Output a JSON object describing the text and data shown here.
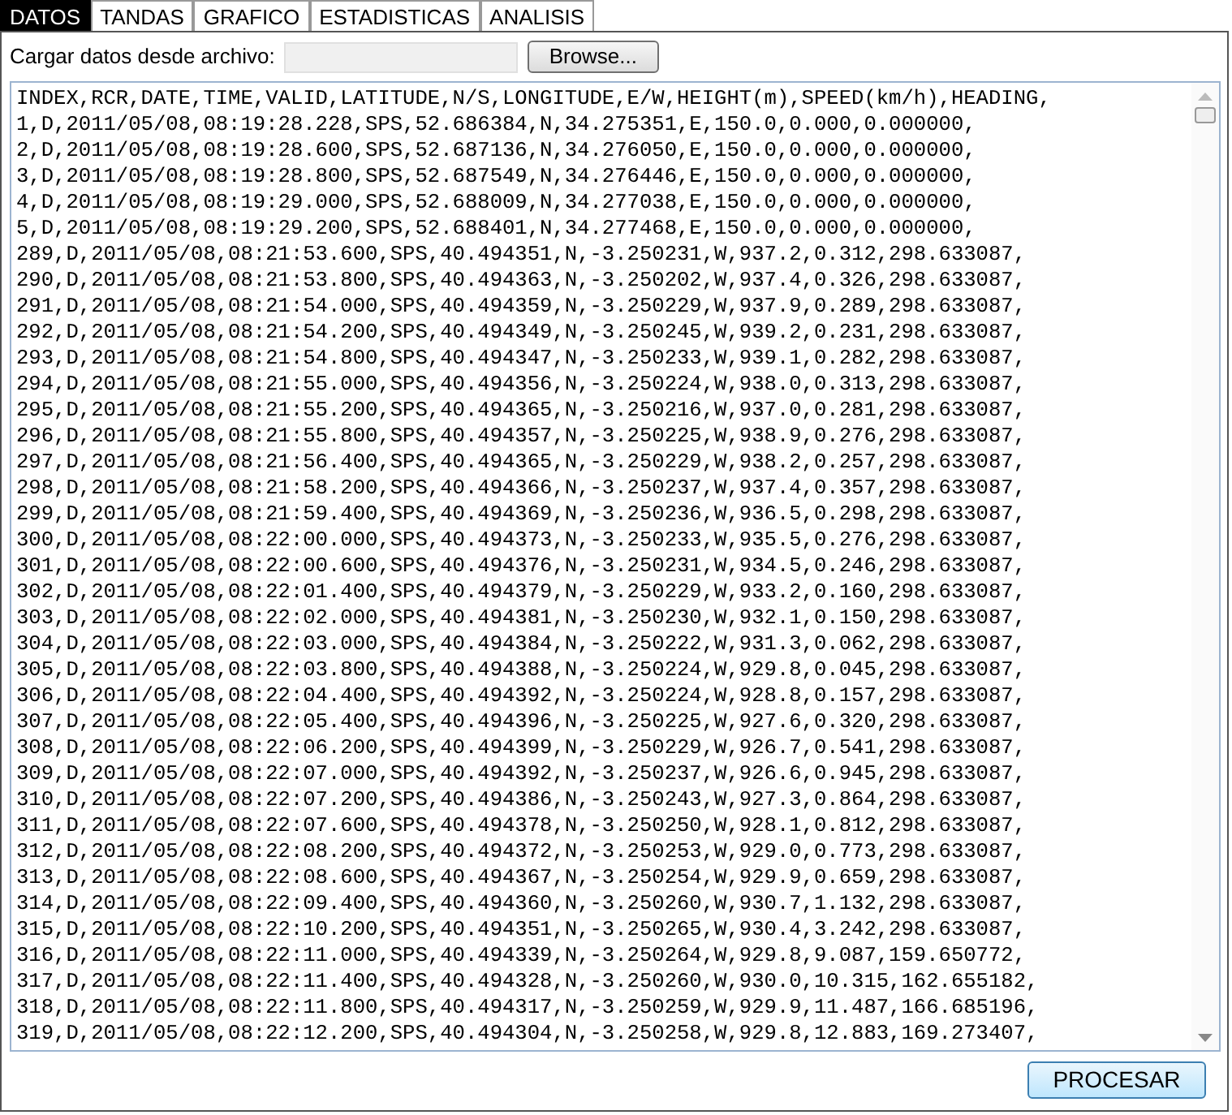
{
  "tabs": [
    {
      "label": "DATOS",
      "selected": true
    },
    {
      "label": "TANDAS",
      "selected": false
    },
    {
      "label": "GRAFICO",
      "selected": false
    },
    {
      "label": "ESTADISTICAS",
      "selected": false
    },
    {
      "label": "ANALISIS",
      "selected": false
    }
  ],
  "file_label": "Cargar datos desde archivo:",
  "browse_button": "Browse...",
  "lines": [
    "INDEX,RCR,DATE,TIME,VALID,LATITUDE,N/S,LONGITUDE,E/W,HEIGHT(m),SPEED(km/h),HEADING,",
    "1,D,2011/05/08,08:19:28.228,SPS,52.686384,N,34.275351,E,150.0,0.000,0.000000,",
    "2,D,2011/05/08,08:19:28.600,SPS,52.687136,N,34.276050,E,150.0,0.000,0.000000,",
    "3,D,2011/05/08,08:19:28.800,SPS,52.687549,N,34.276446,E,150.0,0.000,0.000000,",
    "4,D,2011/05/08,08:19:29.000,SPS,52.688009,N,34.277038,E,150.0,0.000,0.000000,",
    "5,D,2011/05/08,08:19:29.200,SPS,52.688401,N,34.277468,E,150.0,0.000,0.000000,",
    "289,D,2011/05/08,08:21:53.600,SPS,40.494351,N,-3.250231,W,937.2,0.312,298.633087,",
    "290,D,2011/05/08,08:21:53.800,SPS,40.494363,N,-3.250202,W,937.4,0.326,298.633087,",
    "291,D,2011/05/08,08:21:54.000,SPS,40.494359,N,-3.250229,W,937.9,0.289,298.633087,",
    "292,D,2011/05/08,08:21:54.200,SPS,40.494349,N,-3.250245,W,939.2,0.231,298.633087,",
    "293,D,2011/05/08,08:21:54.800,SPS,40.494347,N,-3.250233,W,939.1,0.282,298.633087,",
    "294,D,2011/05/08,08:21:55.000,SPS,40.494356,N,-3.250224,W,938.0,0.313,298.633087,",
    "295,D,2011/05/08,08:21:55.200,SPS,40.494365,N,-3.250216,W,937.0,0.281,298.633087,",
    "296,D,2011/05/08,08:21:55.800,SPS,40.494357,N,-3.250225,W,938.9,0.276,298.633087,",
    "297,D,2011/05/08,08:21:56.400,SPS,40.494365,N,-3.250229,W,938.2,0.257,298.633087,",
    "298,D,2011/05/08,08:21:58.200,SPS,40.494366,N,-3.250237,W,937.4,0.357,298.633087,",
    "299,D,2011/05/08,08:21:59.400,SPS,40.494369,N,-3.250236,W,936.5,0.298,298.633087,",
    "300,D,2011/05/08,08:22:00.000,SPS,40.494373,N,-3.250233,W,935.5,0.276,298.633087,",
    "301,D,2011/05/08,08:22:00.600,SPS,40.494376,N,-3.250231,W,934.5,0.246,298.633087,",
    "302,D,2011/05/08,08:22:01.400,SPS,40.494379,N,-3.250229,W,933.2,0.160,298.633087,",
    "303,D,2011/05/08,08:22:02.000,SPS,40.494381,N,-3.250230,W,932.1,0.150,298.633087,",
    "304,D,2011/05/08,08:22:03.000,SPS,40.494384,N,-3.250222,W,931.3,0.062,298.633087,",
    "305,D,2011/05/08,08:22:03.800,SPS,40.494388,N,-3.250224,W,929.8,0.045,298.633087,",
    "306,D,2011/05/08,08:22:04.400,SPS,40.494392,N,-3.250224,W,928.8,0.157,298.633087,",
    "307,D,2011/05/08,08:22:05.400,SPS,40.494396,N,-3.250225,W,927.6,0.320,298.633087,",
    "308,D,2011/05/08,08:22:06.200,SPS,40.494399,N,-3.250229,W,926.7,0.541,298.633087,",
    "309,D,2011/05/08,08:22:07.000,SPS,40.494392,N,-3.250237,W,926.6,0.945,298.633087,",
    "310,D,2011/05/08,08:22:07.200,SPS,40.494386,N,-3.250243,W,927.3,0.864,298.633087,",
    "311,D,2011/05/08,08:22:07.600,SPS,40.494378,N,-3.250250,W,928.1,0.812,298.633087,",
    "312,D,2011/05/08,08:22:08.200,SPS,40.494372,N,-3.250253,W,929.0,0.773,298.633087,",
    "313,D,2011/05/08,08:22:08.600,SPS,40.494367,N,-3.250254,W,929.9,0.659,298.633087,",
    "314,D,2011/05/08,08:22:09.400,SPS,40.494360,N,-3.250260,W,930.7,1.132,298.633087,",
    "315,D,2011/05/08,08:22:10.200,SPS,40.494351,N,-3.250265,W,930.4,3.242,298.633087,",
    "316,D,2011/05/08,08:22:11.000,SPS,40.494339,N,-3.250264,W,929.8,9.087,159.650772,",
    "317,D,2011/05/08,08:22:11.400,SPS,40.494328,N,-3.250260,W,930.0,10.315,162.655182,",
    "318,D,2011/05/08,08:22:11.800,SPS,40.494317,N,-3.250259,W,929.9,11.487,166.685196,",
    "319,D,2011/05/08,08:22:12.200,SPS,40.494304,N,-3.250258,W,929.8,12.883,169.273407,"
  ],
  "process_button": "PROCESAR"
}
